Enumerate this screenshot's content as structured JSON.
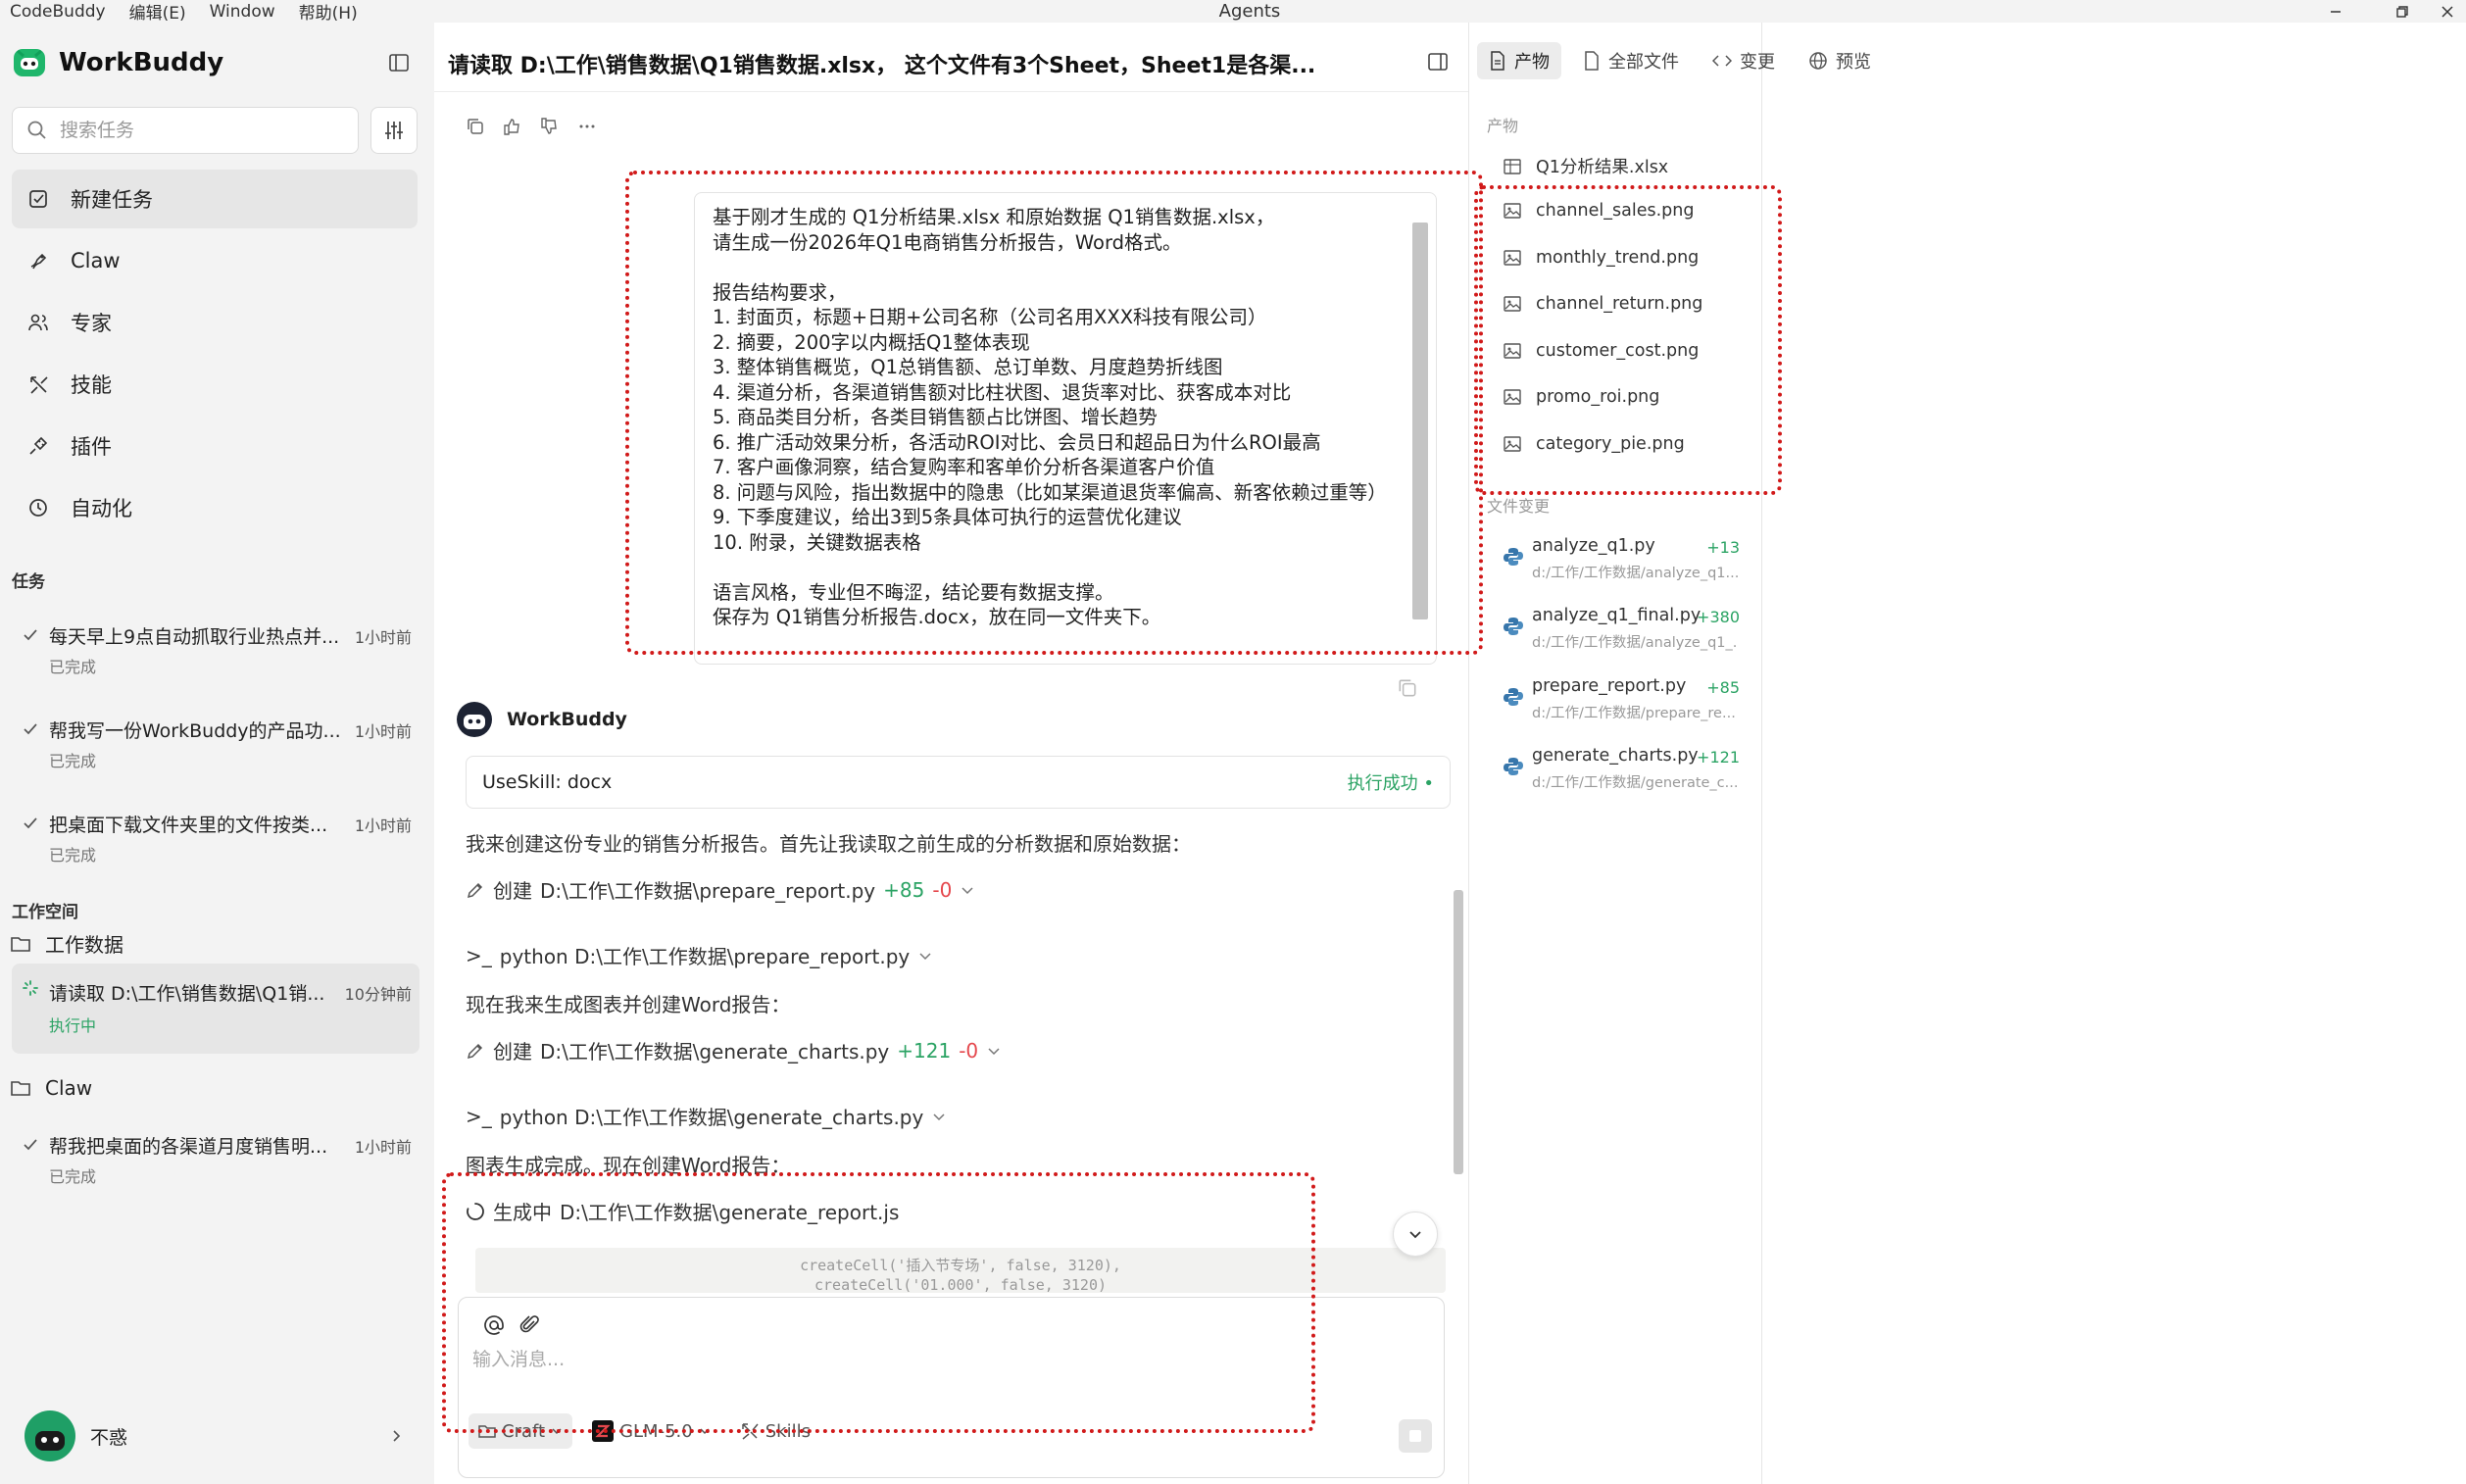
{
  "titlebar": {
    "menu": [
      "CodeBuddy",
      "编辑(E)",
      "Window",
      "帮助(H)"
    ],
    "app_title": "Agents"
  },
  "sidebar": {
    "brand": "WorkBuddy",
    "search_placeholder": "搜索任务",
    "nav": [
      "新建任务",
      "Claw",
      "专家",
      "技能",
      "插件",
      "自动化"
    ],
    "tasks_label": "任务",
    "tasks": [
      {
        "title": "每天早上9点自动抓取行业热点并...",
        "time": "1小时前",
        "status": "已完成"
      },
      {
        "title": "帮我写一份WorkBuddy的产品功...",
        "time": "1小时前",
        "status": "已完成"
      },
      {
        "title": "把桌面下载文件夹里的文件按类...",
        "time": "1小时前",
        "status": "已完成"
      }
    ],
    "workspace_label": "工作空间",
    "workspace_folder": "工作数据",
    "active_task": {
      "title": "请读取 D:\\工作\\销售数据\\Q1销...",
      "time": "10分钟前",
      "status": "执行中"
    },
    "claw_folder": "Claw",
    "claw_task": {
      "title": "帮我把桌面的各渠道月度销售明...",
      "time": "1小时前",
      "status": "已完成"
    },
    "user_name": "不惑"
  },
  "chat": {
    "title": "请读取 D:\\工作\\销售数据\\Q1销售数据.xlsx， 这个文件有3个Sheet，Sheet1是各渠...",
    "user_message": "基于刚才生成的 Q1分析结果.xlsx 和原始数据 Q1销售数据.xlsx，\n请生成一份2026年Q1电商销售分析报告，Word格式。\n\n报告结构要求，\n1. 封面页，标题+日期+公司名称（公司名用XXX科技有限公司）\n2. 摘要，200字以内概括Q1整体表现\n3. 整体销售概览，Q1总销售额、总订单数、月度趋势折线图\n4. 渠道分析，各渠道销售额对比柱状图、退货率对比、获客成本对比\n5. 商品类目分析，各类目销售额占比饼图、增长趋势\n6. 推广活动效果分析，各活动ROI对比、会员日和超品日为什么ROI最高\n7. 客户画像洞察，结合复购率和客单价分析各渠道客户价值\n8. 问题与风险，指出数据中的隐患（比如某渠道退货率偏高、新客依赖过重等）\n9. 下季度建议，给出3到5条具体可执行的运营优化建议\n10. 附录，关键数据表格\n\n语言风格，专业但不晦涩，结论要有数据支撑。\n保存为 Q1销售分析报告.docx，放在同一文件夹下。",
    "bot_name": "WorkBuddy",
    "skill_label": "UseSkill: docx",
    "skill_status": "执行成功",
    "intro": "我来创建这份专业的销售分析报告。首先让我读取之前生成的分析数据和原始数据：",
    "create1": {
      "prefix": "创建",
      "path": "D:\\工作\\工作数据\\prepare_report.py",
      "add": "+85",
      "del": "-0"
    },
    "run1": {
      "prefix": ">_",
      "cmd": "python D:\\工作\\工作数据\\prepare_report.py"
    },
    "mid": "现在我来生成图表并创建Word报告：",
    "create2": {
      "prefix": "创建",
      "path": "D:\\工作\\工作数据\\generate_charts.py",
      "add": "+121",
      "del": "-0"
    },
    "run2": {
      "prefix": ">_",
      "cmd": "python D:\\工作\\工作数据\\generate_charts.py"
    },
    "done": "图表生成完成。现在创建Word报告：",
    "generating": {
      "prefix": "生成中",
      "path": "D:\\工作\\工作数据\\generate_report.js"
    },
    "code_lines": [
      "createCell('插入节专场', false, 3120),",
      "createCell('01.000', false, 3120)"
    ],
    "input_placeholder": "输入消息...",
    "mode": "Craft",
    "model": "GLM-5.0",
    "skills": "Skills"
  },
  "right_panel": {
    "tabs": [
      "产物",
      "全部文件",
      "变更",
      "预览"
    ],
    "artifacts_label": "产物",
    "artifacts": [
      "Q1分析结果.xlsx",
      "channel_sales.png",
      "monthly_trend.png",
      "channel_return.png",
      "customer_cost.png",
      "promo_roi.png",
      "category_pie.png"
    ],
    "changes_label": "文件变更",
    "changes": [
      {
        "name": "analyze_q1.py",
        "count": "+13",
        "path": "d:/工作/工作数据/analyze_q1..."
      },
      {
        "name": "analyze_q1_final.py",
        "count": "+380",
        "path": "d:/工作/工作数据/analyze_q1_..."
      },
      {
        "name": "prepare_report.py",
        "count": "+85",
        "path": "d:/工作/工作数据/prepare_re..."
      },
      {
        "name": "generate_charts.py",
        "count": "+121",
        "path": "d:/工作/工作数据/generate_c..."
      }
    ]
  },
  "colors": {
    "accent_green": "#2ba364",
    "annotation_red": "#d11a1a",
    "python_blue": "#3776ab"
  }
}
